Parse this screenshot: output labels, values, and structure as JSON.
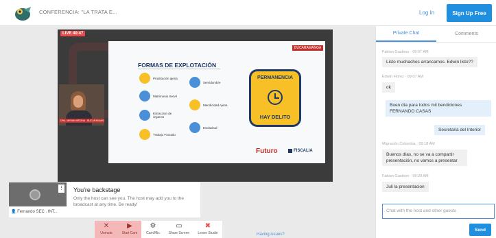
{
  "header": {
    "conference_title": "CONFERENCIA: \"LA TRATA E...",
    "login_label": "Log In",
    "signup_label": "Sign Up Free"
  },
  "stage": {
    "live_badge": "LIVE 40:47",
    "slide": {
      "tag": "BUCARAMANGA",
      "title": "FORMAS DE EXPLOTACIÓN",
      "items_left": [
        "Prostitución ajena",
        "Matrimonio Servil",
        "Extracción de órganos",
        "Trabajo Forzado"
      ],
      "items_right": [
        "Servidumbre",
        "Mendicidad Ajena",
        "Esclavitud"
      ],
      "highlight_top": "PERMANENCIA",
      "highlight_bottom": "HAY DELITO",
      "footer_left": "Futuro",
      "footer_right": "FISCALIA"
    },
    "camera_caption": "DRA. MIRIAN MEDINA - BUCARAMANGA",
    "self_view_name": "Fernando SEC . INT...",
    "self_view_more": "⋮",
    "backstage": {
      "heading": "You're backstage",
      "text": "Only the host can see you. The host may add you to the broadcast at any time. Be ready!"
    },
    "controls": [
      {
        "label": "Unmute",
        "icon": "mic-off-icon",
        "glyph": "✕"
      },
      {
        "label": "Start Cam",
        "icon": "camera-off-icon",
        "glyph": "▶"
      },
      {
        "label": "Cam/Mic",
        "icon": "gear-icon",
        "glyph": "⚙"
      },
      {
        "label": "Share Screen",
        "icon": "monitor-icon",
        "glyph": "▭"
      },
      {
        "label": "Leave Studio",
        "icon": "close-circle-icon",
        "glyph": "✖"
      }
    ],
    "issues_link": "Having issues?"
  },
  "chat": {
    "tabs": [
      "Private Chat",
      "Comments"
    ],
    "messages": [
      {
        "meta": "Fabian Gualtero · 09:07 AM",
        "text": "Listo muchachos arrancamos. Edwin listo??"
      },
      {
        "meta": "Edwin Florez · 09:07 AM",
        "text": "ok"
      },
      {
        "meta": "",
        "text": "Buen día para todos mil bendiciones FERNANDO CASAS"
      },
      {
        "meta": "",
        "text": "Secretaria del Interior"
      },
      {
        "meta": "Migración Colombia · 09:18 AM",
        "text": "Buenos días, no se va a compartir presentación, no vamos a presentar"
      },
      {
        "meta": "Fabian Gualtero · 09:29 AM",
        "text": "Juli la presentacion"
      }
    ],
    "input_placeholder": "Chat with the host and other guests",
    "send_label": "Send"
  },
  "colors": {
    "accent": "#1f8fe0",
    "live": "#e84a4a",
    "highlight": "#f6c026",
    "navy": "#1f3864"
  }
}
